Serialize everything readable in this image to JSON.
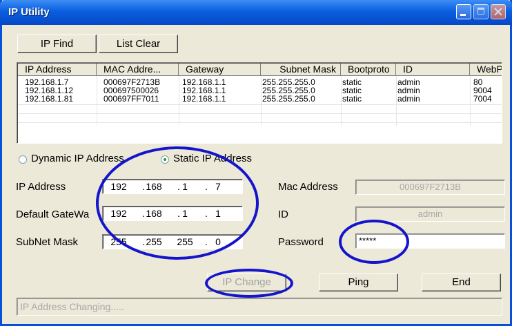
{
  "window": {
    "title": "IP Utility"
  },
  "toolbar": {
    "ip_find_label": "IP Find",
    "list_clear_label": "List Clear"
  },
  "table": {
    "columns": [
      "IP Address",
      "MAC Addre...",
      "Gateway",
      "Subnet Mask",
      "Bootproto",
      "ID",
      "WebP"
    ],
    "rows": [
      [
        "192.168.1.7",
        "000697F2713B",
        "192.168.1.1",
        "255.255.255.0",
        "static",
        "admin",
        "80"
      ],
      [
        "192.168.1.12",
        "000697500026",
        "192.168.1.1",
        "255.255.255.0",
        "static",
        "admin",
        "9004"
      ],
      [
        "192.168.1.81",
        "000697FF7011",
        "192.168.1.1",
        "255.255.255.0",
        "static",
        "admin",
        "7004"
      ]
    ],
    "scroll_left_icon": "◀",
    "scroll_right_icon": "▶"
  },
  "mode": {
    "dynamic_label": "Dynamic IP Address",
    "static_label": "Static IP Address",
    "selected": "static"
  },
  "form": {
    "ip_label": "IP Address",
    "gateway_label": "Default GateWa",
    "subnet_label": "SubNet Mask",
    "ip": [
      "192",
      "168",
      "1",
      "7"
    ],
    "gateway": [
      "192",
      "168",
      "1",
      "1"
    ],
    "subnet": [
      "255",
      "255",
      "255",
      "0"
    ],
    "octet_separator": ".",
    "mac_label": "Mac Address",
    "mac_value": "000697F2713B",
    "id_label": "ID",
    "id_value": "admin",
    "password_label": "Password",
    "password_value": "*****"
  },
  "actions": {
    "ip_change_label": "IP Change",
    "ping_label": "Ping",
    "end_label": "End"
  },
  "status": {
    "text": "IP Address Changing....."
  },
  "colors": {
    "titlebar": "#0a5fe0",
    "window_bg": "#ece9d8",
    "annotation": "#1414cc",
    "radio_dot": "#21a121"
  }
}
